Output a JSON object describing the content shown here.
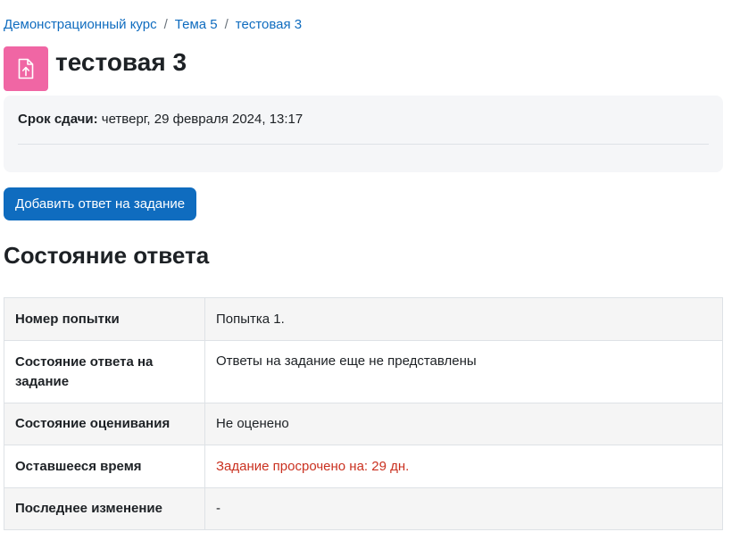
{
  "breadcrumb": {
    "items": [
      "Демонстрационный курс",
      "Тема 5",
      "тестовая 3"
    ],
    "separator": "/"
  },
  "header": {
    "icon": "assignment-upload-icon",
    "icon_color": "#f066a4",
    "title": "тестовая 3"
  },
  "dates": {
    "due_label": "Срок сдачи:",
    "due_value": "четверг, 29 февраля 2024, 13:17"
  },
  "actions": {
    "add_submission_label": "Добавить ответ на задание",
    "accent_color": "#0f6cbf"
  },
  "submission_status": {
    "title": "Состояние ответа",
    "rows": [
      {
        "label": "Номер попытки",
        "value": "Попытка 1."
      },
      {
        "label": "Состояние ответа на задание",
        "value": "Ответы на задание еще не представлены"
      },
      {
        "label": "Состояние оценивания",
        "value": "Не оценено"
      },
      {
        "label": "Оставшееся время",
        "value": "Задание просрочено на: 29 дн.",
        "value_color": "#ca3120"
      },
      {
        "label": "Последнее изменение",
        "value": "-"
      }
    ]
  }
}
